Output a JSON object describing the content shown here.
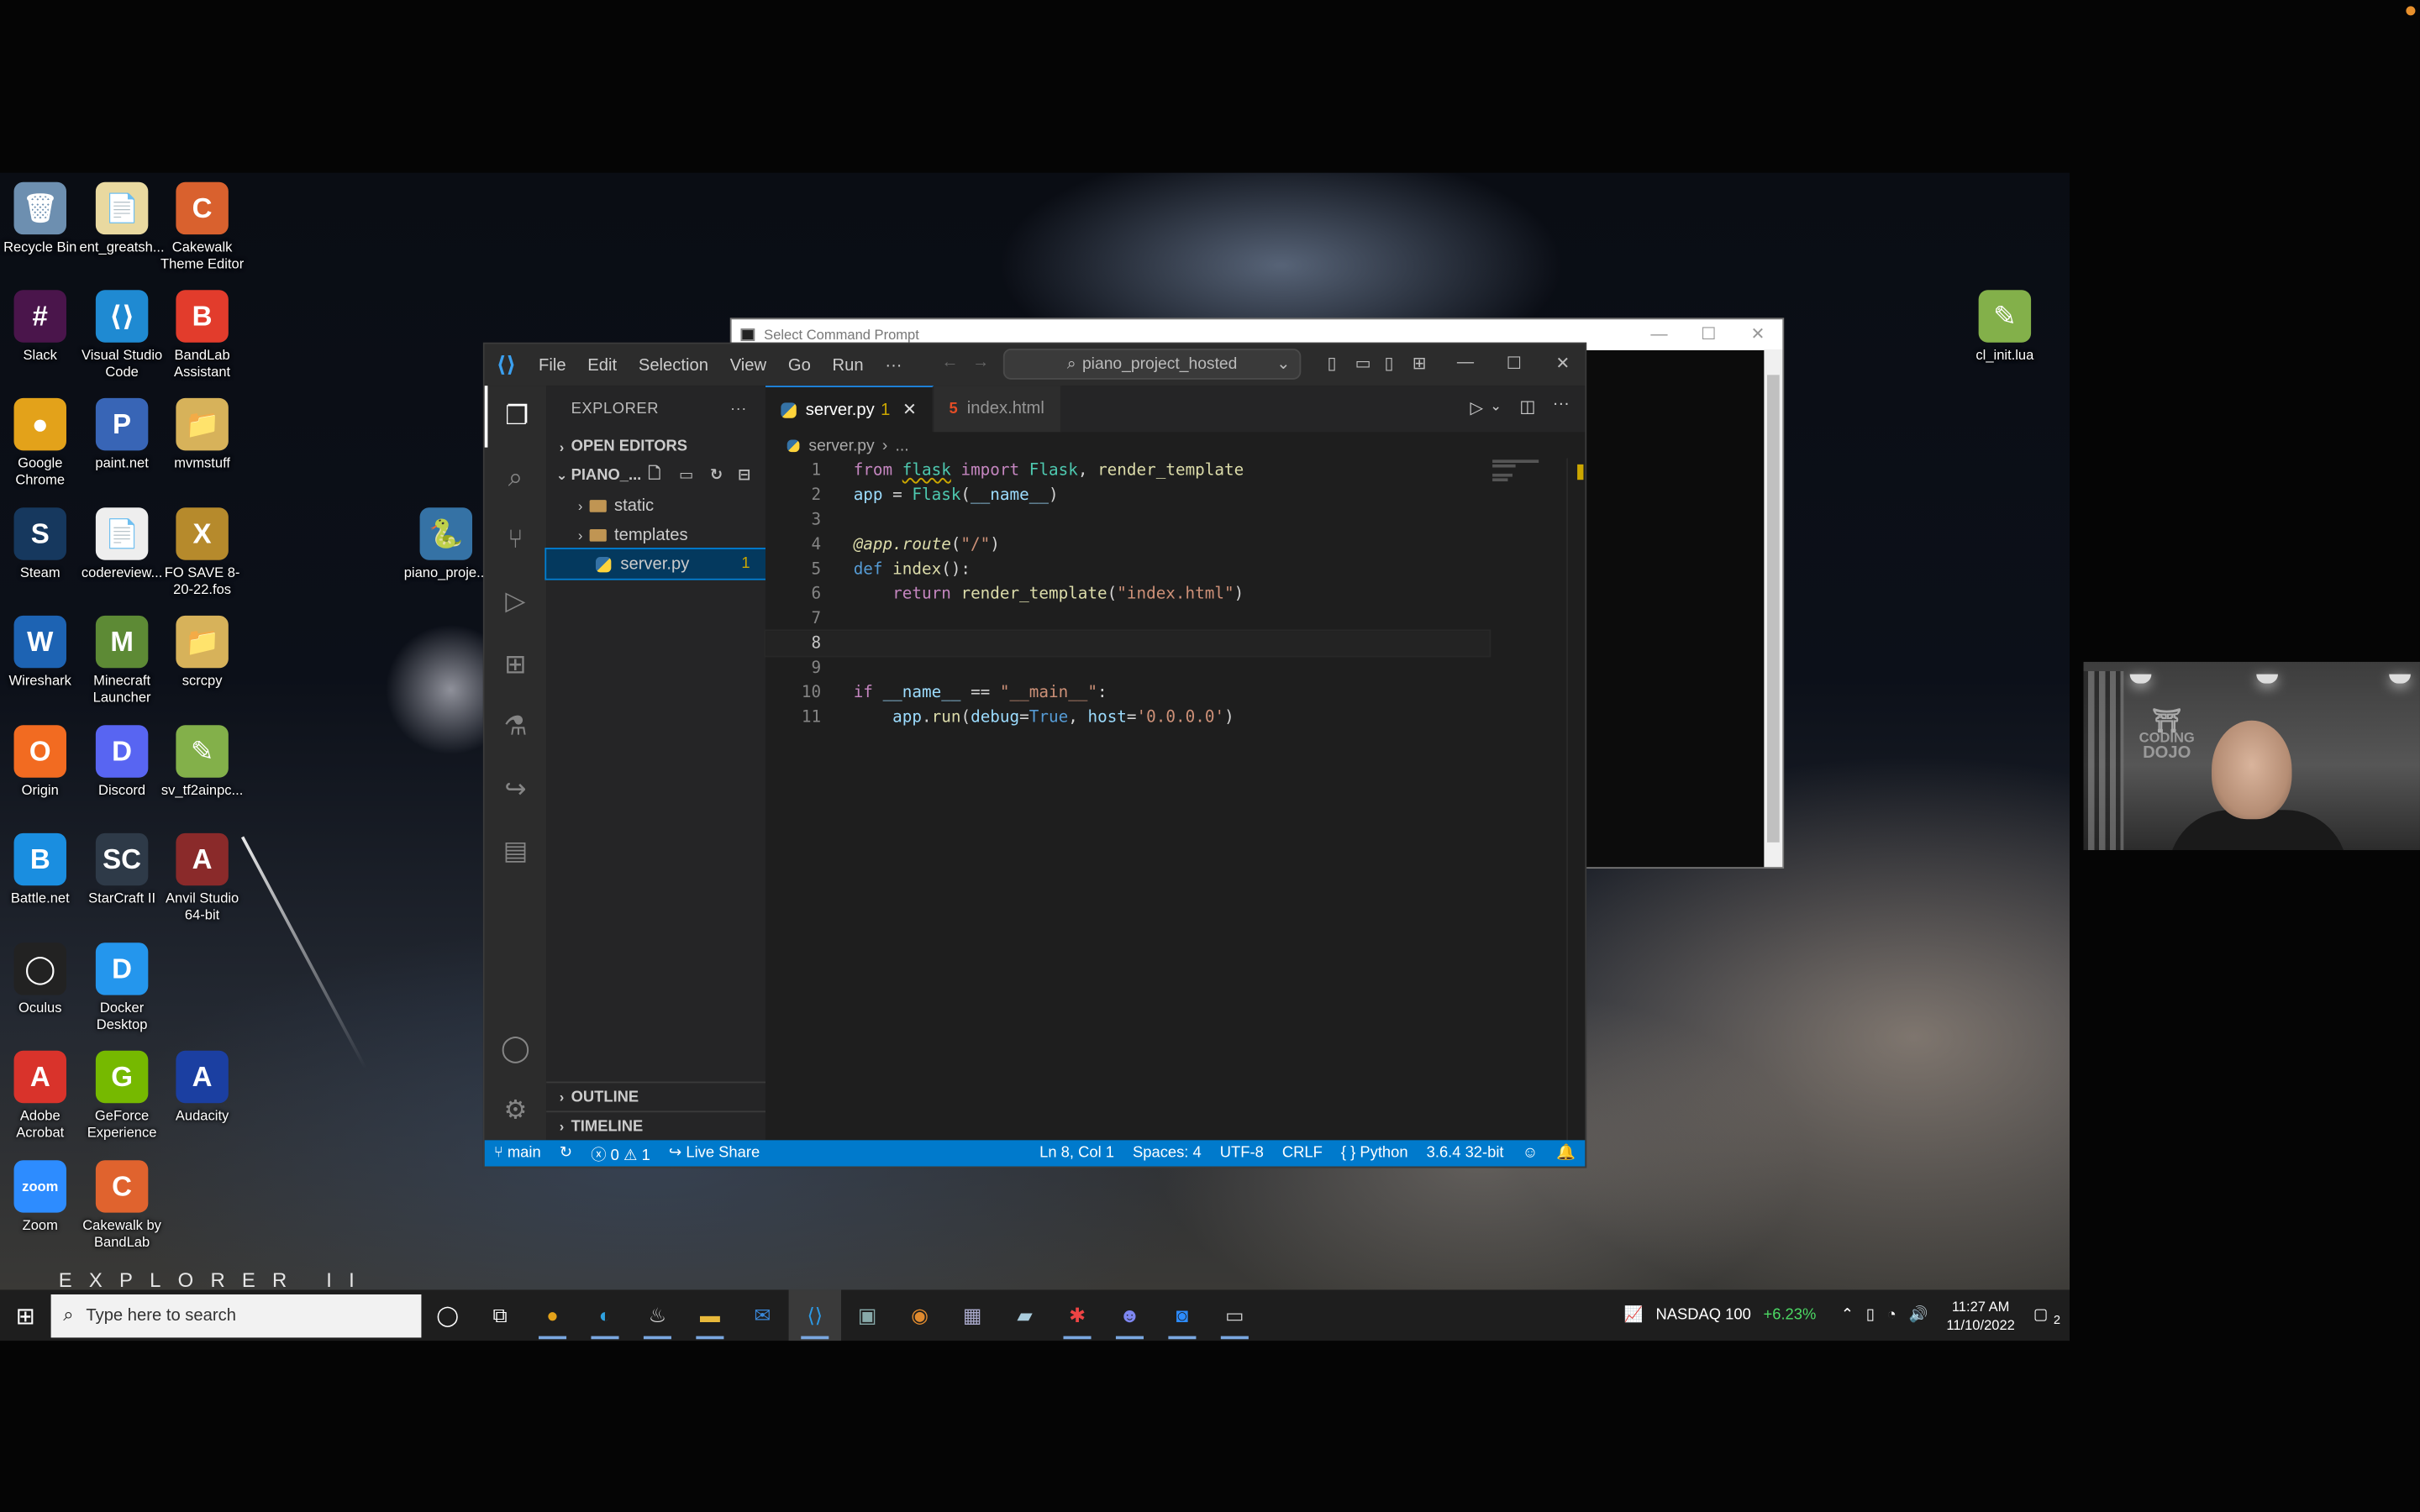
{
  "desktop": {
    "watermark": "EXPLORER II",
    "icons": [
      {
        "label": "Recycle Bin",
        "glyph": "🗑",
        "color": "#6d8fb0"
      },
      {
        "label": "ent_greatsh...",
        "glyph": "📄",
        "color": "#e9d9a0"
      },
      {
        "label": "Cakewalk Theme Editor",
        "glyph": "C",
        "color": "#d9612e"
      },
      {
        "label": "Slack",
        "glyph": "#",
        "color": "#4a154b"
      },
      {
        "label": "Visual Studio Code",
        "glyph": "⟨⟩",
        "color": "#1f8ad2"
      },
      {
        "label": "BandLab Assistant",
        "glyph": "B",
        "color": "#e23c2c"
      },
      {
        "label": "Google Chrome",
        "glyph": "●",
        "color": "#e3a21a"
      },
      {
        "label": "paint.net",
        "glyph": "P",
        "color": "#3865b6"
      },
      {
        "label": "mvmstuff",
        "glyph": "📁",
        "color": "#d7b25a"
      },
      {
        "label": "Steam",
        "glyph": "S",
        "color": "#16385e"
      },
      {
        "label": "codereview...",
        "glyph": "📄",
        "color": "#eeeeee"
      },
      {
        "label": "FO SAVE 8-20-22.fos",
        "glyph": "X",
        "color": "#b68a2c"
      },
      {
        "label": "Wireshark",
        "glyph": "W",
        "color": "#1d63b3"
      },
      {
        "label": "Minecraft Launcher",
        "glyph": "M",
        "color": "#5d8a35"
      },
      {
        "label": "scrcpy",
        "glyph": "📁",
        "color": "#d7b25a"
      },
      {
        "label": "Origin",
        "glyph": "O",
        "color": "#f26b21"
      },
      {
        "label": "Discord",
        "glyph": "D",
        "color": "#5865f2"
      },
      {
        "label": "sv_tf2ainpc...",
        "glyph": "✎",
        "color": "#83b04a"
      },
      {
        "label": "Battle.net",
        "glyph": "B",
        "color": "#1a8ee0"
      },
      {
        "label": "StarCraft II",
        "glyph": "SC",
        "color": "#2e3a48"
      },
      {
        "label": "Anvil Studio 64-bit",
        "glyph": "A",
        "color": "#8a2a2a"
      },
      {
        "label": "Oculus",
        "glyph": "◯",
        "color": "#222222"
      },
      {
        "label": "Docker Desktop",
        "glyph": "D",
        "color": "#2496ed"
      },
      {
        "label": "Adobe Acrobat",
        "glyph": "A",
        "color": "#d9332b"
      },
      {
        "label": "GeForce Experience",
        "glyph": "G",
        "color": "#76b900"
      },
      {
        "label": "Audacity",
        "glyph": "A",
        "color": "#1b3fa1"
      },
      {
        "label": "Zoom",
        "glyph": "zoom",
        "color": "#2d8cff"
      },
      {
        "label": "Cakewalk by BandLab",
        "glyph": "C",
        "color": "#e0632e"
      },
      {
        "label": "piano_proje...",
        "glyph": "🐍",
        "color": "#3572a5"
      },
      {
        "label": "cl_init.lua",
        "glyph": "✎",
        "color": "#83b04a"
      }
    ]
  },
  "cmd": {
    "title": "Select Command Prompt",
    "minimize": "—",
    "maximize": "☐",
    "close": "✕"
  },
  "vscode": {
    "menu": [
      "File",
      "Edit",
      "Selection",
      "View",
      "Go",
      "Run",
      "···"
    ],
    "search": "piano_project_hosted",
    "window_buttons": {
      "minimize": "—",
      "maximize": "☐",
      "close": "✕"
    },
    "explorer": {
      "title": "EXPLORER",
      "more": "···",
      "open_editors": "OPEN EDITORS",
      "project": "PIANO_...",
      "tree": [
        {
          "name": "static",
          "type": "folder"
        },
        {
          "name": "templates",
          "type": "folder"
        },
        {
          "name": "server.py",
          "type": "file",
          "badge": "1"
        }
      ],
      "outline": "OUTLINE",
      "timeline": "TIMELINE"
    },
    "tabs": [
      {
        "label": "server.py",
        "badge": "1",
        "active": true,
        "icon": "python-icon"
      },
      {
        "label": "index.html",
        "active": false,
        "icon": "html-icon"
      }
    ],
    "breadcrumb": {
      "file": "server.py",
      "rest": "..."
    },
    "code_lines": [
      "1",
      "2",
      "3",
      "4",
      "5",
      "6",
      "7",
      "8",
      "9",
      "10",
      "11"
    ],
    "cursor_line": 8,
    "status": {
      "branch": "main",
      "errors": "0",
      "warnings": "1",
      "live_share": "Live Share",
      "position": "Ln 8, Col 1",
      "spaces": "Spaces: 4",
      "encoding": "UTF-8",
      "eol": "CRLF",
      "language": "Python",
      "interpreter": "3.6.4 32-bit"
    }
  },
  "webcam": {
    "logo_line1": "CODING",
    "logo_line2": "DOJO"
  },
  "taskbar": {
    "search_placeholder": "Type here to search",
    "stock": "NASDAQ 100",
    "stock_change": "+6.23%",
    "time": "11:27 AM",
    "date": "11/10/2022",
    "notifications": "2"
  }
}
